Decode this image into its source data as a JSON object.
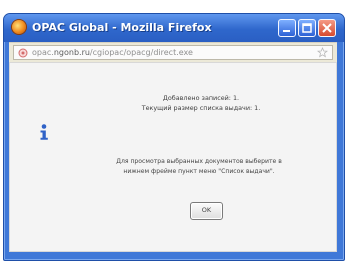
{
  "window": {
    "title": "OPAC Global - Mozilla Firefox"
  },
  "address_bar": {
    "url_prefix": "opac.",
    "url_domain": "ngonb.ru",
    "url_path": "/cgiopac/opacg/direct.exe"
  },
  "dialog": {
    "line1": "Добавлено записей: 1.",
    "line2": "Текущий размер списка выдачи: 1.",
    "instruction_line1": "Для просмотра выбранных документов выберите в",
    "instruction_line2": "нижнем фрейме пункт меню \"Список выдачи\".",
    "ok_label": "OK"
  },
  "colors": {
    "titlebar_top": "#5f97ee",
    "titlebar_bottom": "#2a5fc3",
    "info_icon": "#2f62c7",
    "content_background": "#f4f4f4"
  },
  "icons": {
    "app": "firefox-icon",
    "site": "site-identity-icon",
    "bookmark": "bookmark-star-icon",
    "message": "info-icon"
  }
}
